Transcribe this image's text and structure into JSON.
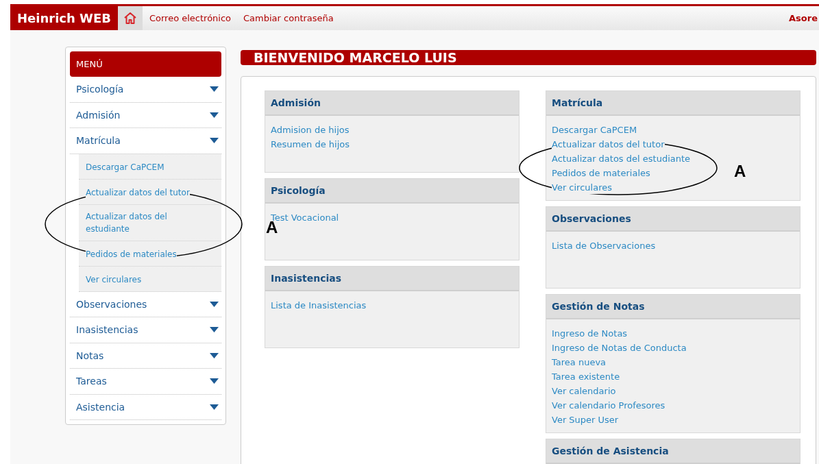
{
  "header": {
    "brand": "Heinrich WEB",
    "links": [
      "Correo electrónico",
      "Cambiar contraseña"
    ],
    "user": "Asore"
  },
  "sidebar": {
    "title": "MENÚ",
    "items": [
      {
        "label": "Psicología"
      },
      {
        "label": "Admisión"
      },
      {
        "label": "Matrícula",
        "children": [
          "Descargar CaPCEM",
          "Actualizar datos del tutor",
          "Actualizar datos del estudiante",
          "Pedidos de materiales",
          "Ver circulares"
        ]
      },
      {
        "label": "Observaciones"
      },
      {
        "label": "Inasistencias"
      },
      {
        "label": "Notas"
      },
      {
        "label": "Tareas"
      },
      {
        "label": "Asistencia"
      }
    ]
  },
  "welcome": "BIENVENIDO MARCELO LUIS",
  "columns": [
    [
      {
        "title": "Admisión",
        "links": [
          "Admision de hijos",
          "Resumen de hijos"
        ]
      },
      {
        "title": "Psicología",
        "links": [
          "Test Vocacional"
        ]
      },
      {
        "title": "Inasistencias",
        "links": [
          "Lista de Inasistencias"
        ]
      }
    ],
    [
      {
        "title": "Matrícula",
        "links": [
          "Descargar CaPCEM",
          "Actualizar datos del tutor",
          "Actualizar datos del estudiante",
          "Pedidos de materiales",
          "Ver circulares"
        ]
      },
      {
        "title": "Observaciones",
        "links": [
          "Lista de Observaciones"
        ]
      },
      {
        "title": "Gestión de Notas",
        "links": [
          "Ingreso de Notas",
          "Ingreso de Notas de Conducta",
          "Tarea nueva",
          "Tarea existente",
          "Ver calendario",
          "Ver calendario Profesores",
          "Ver Super User"
        ]
      },
      {
        "title": "Gestión de Asistencia"
      }
    ]
  ],
  "annotations": [
    {
      "label": "A"
    },
    {
      "label": "A"
    }
  ]
}
